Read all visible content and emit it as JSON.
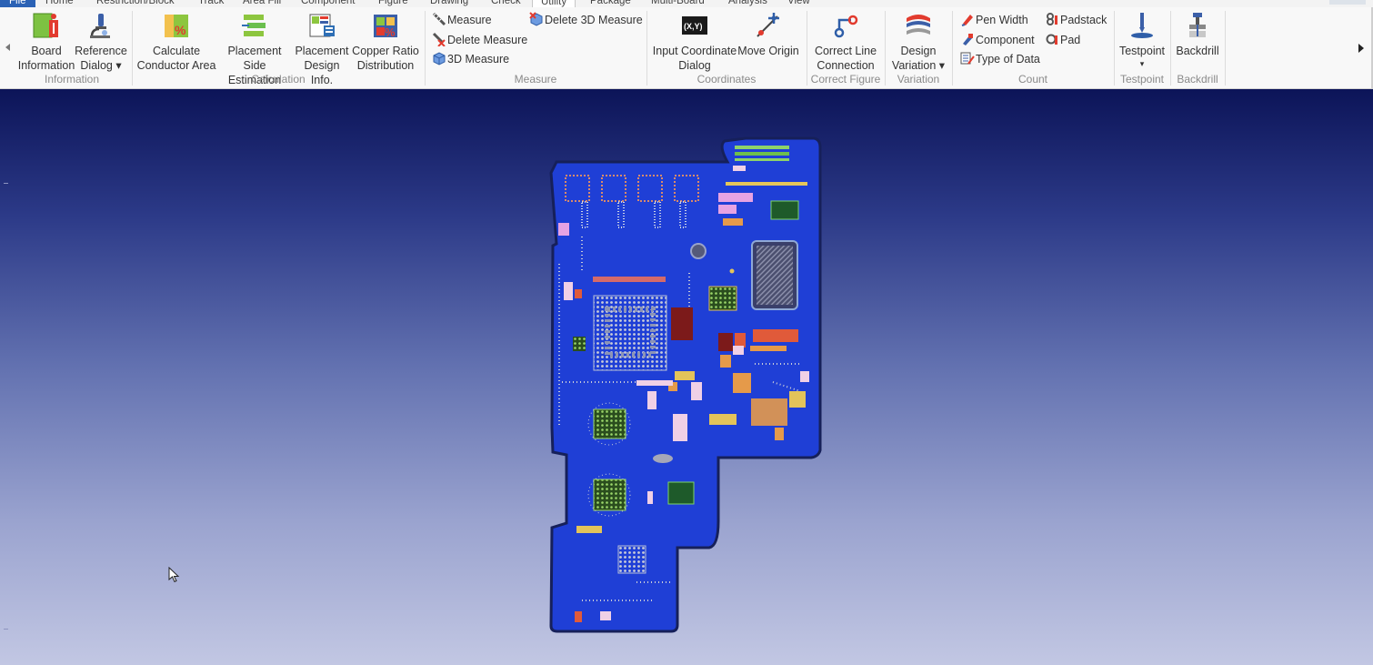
{
  "tabs": [
    {
      "label": "File"
    },
    {
      "label": "Home"
    },
    {
      "label": "Restriction/Block"
    },
    {
      "label": "Track"
    },
    {
      "label": "Area Fill"
    },
    {
      "label": "Component"
    },
    {
      "label": "Figure"
    },
    {
      "label": "Drawing"
    },
    {
      "label": "Check"
    },
    {
      "label": "Utility"
    },
    {
      "label": "Package"
    },
    {
      "label": "Multi-Board"
    },
    {
      "label": "Analysis"
    },
    {
      "label": "View"
    }
  ],
  "active_tab": "Utility",
  "ribbon": {
    "information": {
      "label": "Information",
      "board_information": "Board Information",
      "board_information_l1": "Board",
      "board_information_l2": "Information",
      "reference_dialog_l1": "Reference",
      "reference_dialog_l2": "Dialog ▾"
    },
    "calculation": {
      "label": "Calculation",
      "calc_l1": "Calculate",
      "calc_l2": "Conductor Area",
      "pse_l1": "Placement Side",
      "pse_l2": "Estimation",
      "pdi_l1": "Placement",
      "pdi_l2": "Design Info.",
      "crd_l1": "Copper Ratio",
      "crd_l2": "Distribution"
    },
    "measure": {
      "label": "Measure",
      "measure": "Measure",
      "delete_measure": "Delete Measure",
      "measure_3d": "3D Measure",
      "delete_3d_measure": "Delete 3D Measure"
    },
    "coordinates": {
      "label": "Coordinates",
      "input_l1": "Input Coordinate",
      "input_l2": "Dialog",
      "input_icon_text": "(X,Y)",
      "move_origin": "Move Origin"
    },
    "correct_figure": {
      "label": "Correct Figure",
      "cl_l1": "Correct Line",
      "cl_l2": "Connection"
    },
    "variation": {
      "label": "Variation",
      "dv_l1": "Design",
      "dv_l2": "Variation ▾"
    },
    "count": {
      "label": "Count",
      "pen_width": "Pen Width",
      "component": "Component",
      "type_of_data": "Type of Data",
      "padstack": "Padstack",
      "pad": "Pad"
    },
    "testpoint": {
      "label": "Testpoint",
      "button": "Testpoint",
      "caret": "▾"
    },
    "backdrill": {
      "label": "Backdrill",
      "button": "Backdrill"
    }
  },
  "colors": {
    "file_tab": "#2b62b5",
    "board_fill": "#1f3fd6",
    "board_outline": "#16205a",
    "canvas_top": "#0c1458",
    "canvas_bottom": "#c2c7e3"
  },
  "icons": [
    "board-information-icon",
    "reference-dialog-icon",
    "calculate-conductor-area-icon",
    "placement-side-estimation-icon",
    "placement-design-info-icon",
    "copper-ratio-distribution-icon",
    "measure-icon",
    "delete-measure-icon",
    "3d-measure-icon",
    "delete-3d-measure-icon",
    "input-coordinate-icon",
    "move-origin-icon",
    "correct-line-connection-icon",
    "design-variation-icon",
    "pen-width-icon",
    "component-count-icon",
    "type-of-data-icon",
    "padstack-icon",
    "pad-icon",
    "testpoint-icon",
    "backdrill-icon",
    "mouse-cursor-icon"
  ]
}
